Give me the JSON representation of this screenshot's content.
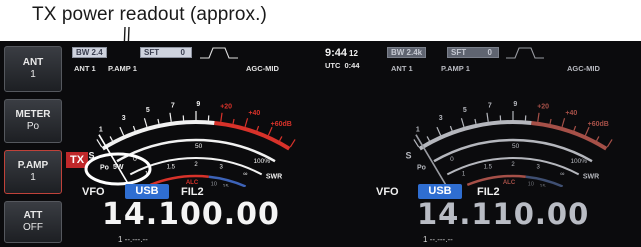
{
  "caption": "TX power readout (approx.)",
  "clock": {
    "time": "9:44",
    "date": "12",
    "utc_label": "UTC",
    "utc_time": "0:44"
  },
  "side_buttons": [
    {
      "label": "ANT",
      "value": "1"
    },
    {
      "label": "METER",
      "value": "Po"
    },
    {
      "label": "P.AMP",
      "value": "1"
    },
    {
      "label": "ATT",
      "value": "OFF"
    }
  ],
  "main": {
    "bw_tag": "BW 2.4",
    "sft_tag": "SFT",
    "sft_value": "0",
    "ant": "ANT 1",
    "pamp": "P.AMP 1",
    "agc": "AGC-MID",
    "tx_label": "TX",
    "po_value": "5W",
    "vfo_label": "VFO",
    "mode": "USB",
    "filter": "FIL2",
    "frequency": "14.100.00",
    "memo": "1 --.---.--"
  },
  "sub": {
    "bw_tag": "BW 2.4k",
    "sft_tag": "SFT",
    "sft_value": "0",
    "ant": "ANT 1",
    "pamp": "P.AMP 1",
    "agc": "AGC-MID",
    "vfo_label": "VFO",
    "mode": "USB",
    "filter": "FIL2",
    "frequency": "14.110.00",
    "memo": "1 --.---.--"
  },
  "meter_scale": {
    "s_label": "S",
    "s_ticks": [
      "1",
      "3",
      "5",
      "7",
      "9"
    ],
    "plus_ticks": [
      "+20",
      "+40",
      "+60dB"
    ],
    "po_label": "Po",
    "po_ticks": [
      "0",
      "50",
      "100%"
    ],
    "swr_label": "SWR",
    "swr_ticks": [
      "1",
      "1.5",
      "2",
      "3",
      "∞"
    ],
    "alc_label": "ALC",
    "comp_label": "COMP",
    "comp_ticks": [
      "10",
      "15",
      "20dB"
    ],
    "id_label": "ID",
    "vd_label": "VD",
    "vd_ticks": [
      "10",
      "12",
      "14",
      "16V"
    ]
  },
  "colors": {
    "accent_red": "#d8322a",
    "mode_blue": "#2f6ed1",
    "main_freq": "#f4f4f4",
    "sub_freq": "#b9bcc4"
  }
}
